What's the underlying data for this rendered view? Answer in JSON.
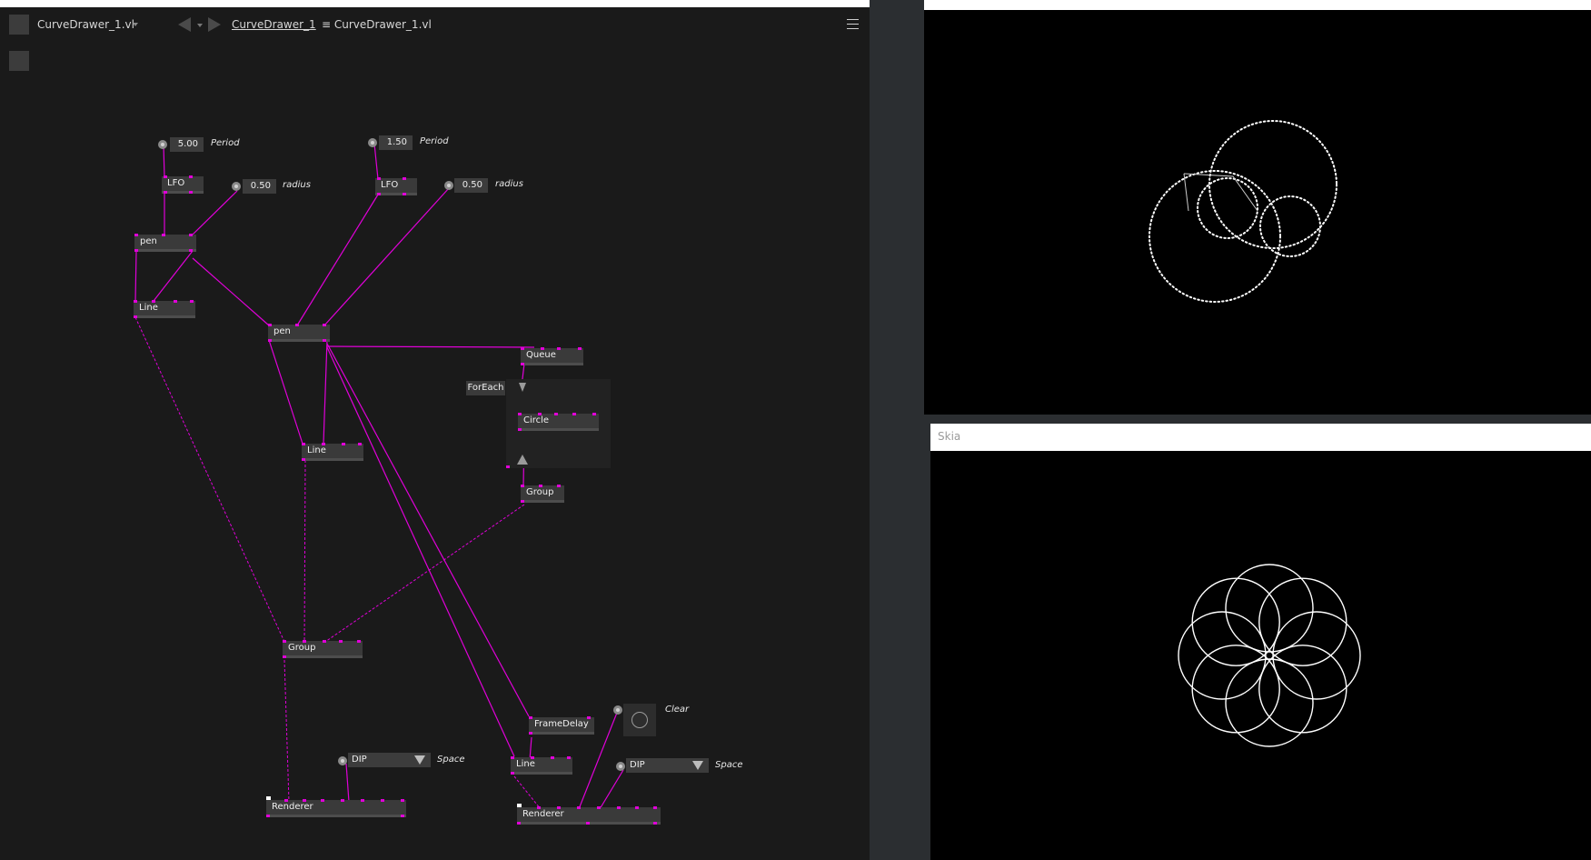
{
  "toolbar": {
    "document_name": "CurveDrawer_1.vl",
    "breadcrumb_link": "CurveDrawer_1",
    "breadcrumb_path": "≡ CurveDrawer_1.vl"
  },
  "patch": {
    "nodes": {
      "lfo1": "LFO",
      "lfo2": "LFO",
      "pen1": "pen",
      "pen2": "pen",
      "line1": "Line",
      "line2": "Line",
      "line3": "Line",
      "queue": "Queue",
      "foreach": "ForEach",
      "circle": "Circle",
      "group_inner": "Group",
      "group_main": "Group",
      "framedelay": "FrameDelay",
      "renderer1": "Renderer",
      "renderer2": "Renderer"
    },
    "iobox_values": {
      "period1": "5.00",
      "radius1": "0.50",
      "period2": "1.50",
      "radius2": "0.50"
    },
    "pin_labels": {
      "period1": "Period",
      "radius1": "radius",
      "period2": "Period",
      "radius2": "radius",
      "space1": "Space",
      "space2": "Space",
      "clear": "Clear"
    },
    "enums": {
      "space1": "DIP",
      "space2": "DIP"
    }
  },
  "skia_window": {
    "title": "Skia"
  },
  "colors": {
    "wire": "#e000d8",
    "editor_bg": "#1a1a1a",
    "node_bg": "#3a3a3a",
    "render_bg": "#000000",
    "curve": "#ffffff"
  }
}
